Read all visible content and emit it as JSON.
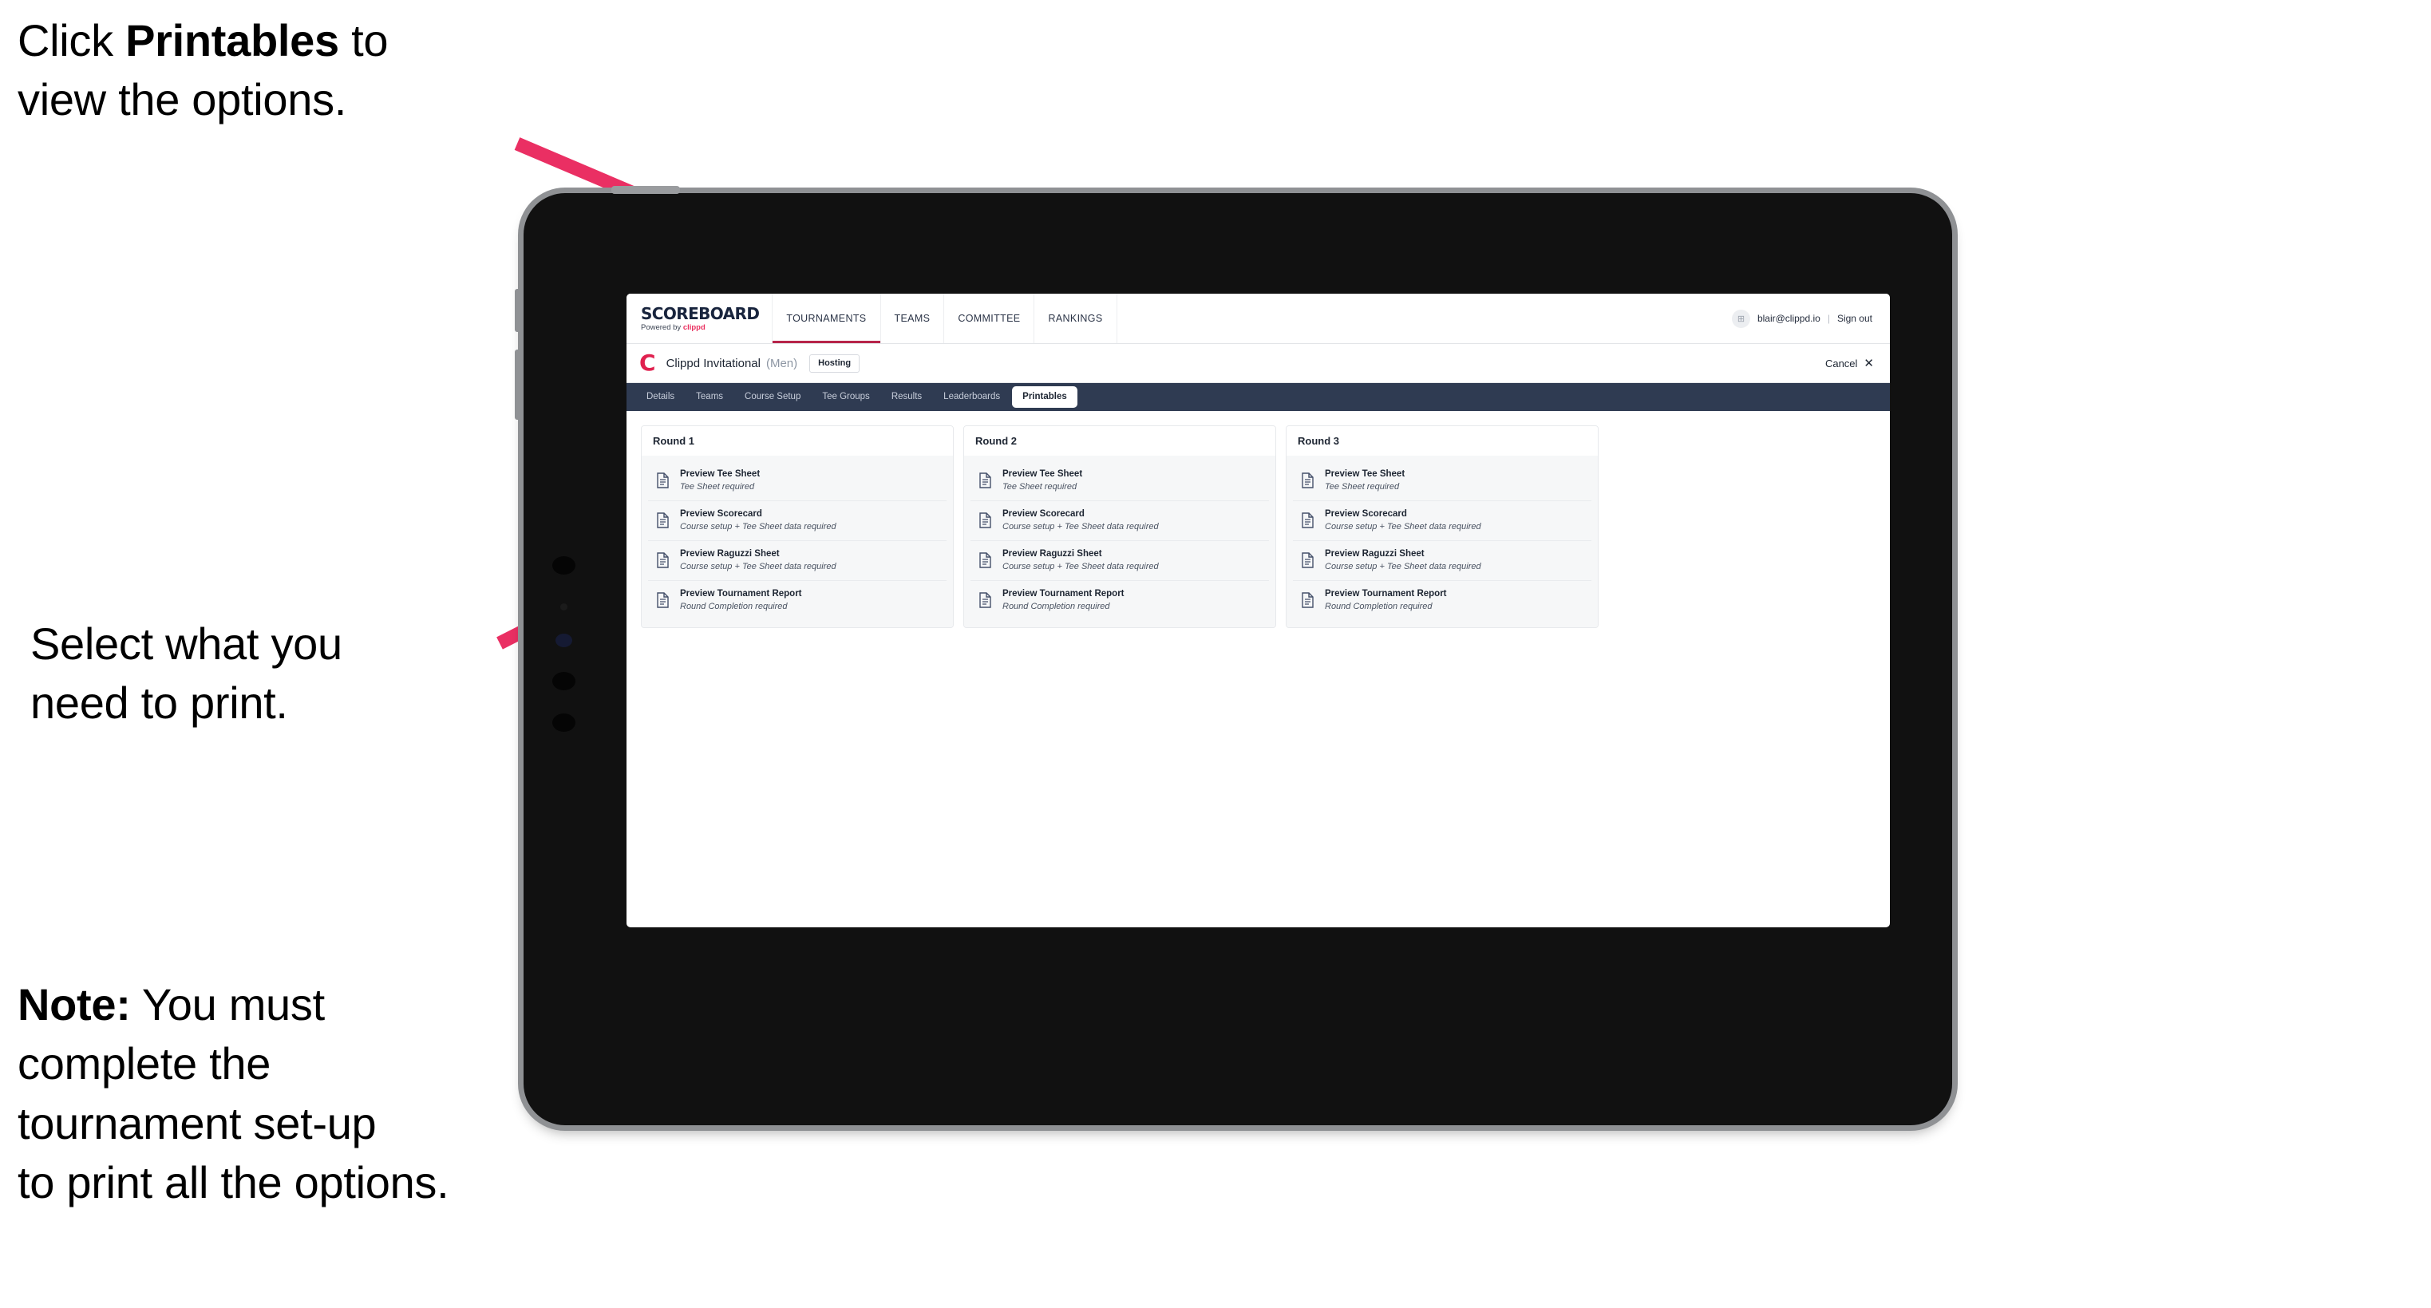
{
  "annotations": {
    "click_printables": "Click Printables to\nview the options.",
    "click_printables_prefix": "Click ",
    "click_printables_bold": "Printables",
    "click_printables_suffix": " to\nview the options.",
    "select_print": "Select what you\n need to print.",
    "note_prefix": "Note:",
    "note_body": " You must\ncomplete the\ntournament set-up\nto print all the options.",
    "arrow_color": "#ea2f63"
  },
  "device": {
    "type": "tablet",
    "bezel_color": "#111111",
    "rail_color": "#8f9194"
  },
  "app": {
    "globalnav": {
      "brand_title": "SCOREBOARD",
      "brand_sub_prefix": "Powered by ",
      "brand_sub_accent": "clippd",
      "items": [
        {
          "label": "TOURNAMENTS",
          "active": true
        },
        {
          "label": "TEAMS",
          "active": false
        },
        {
          "label": "COMMITTEE",
          "active": false
        },
        {
          "label": "RANKINGS",
          "active": false
        }
      ],
      "account_email": "blair@clippd.io",
      "account_separator": "|",
      "sign_out": "Sign out",
      "avatar_glyph": "⊞",
      "active_underline_color": "#b7244a"
    },
    "tournament": {
      "logo_letter": "C",
      "name": "Clippd Invitational",
      "gender": "(Men)",
      "badge": "Hosting",
      "cancel_label": "Cancel",
      "cancel_icon": "✕"
    },
    "tabs": [
      {
        "label": "Details",
        "active": false
      },
      {
        "label": "Teams",
        "active": false
      },
      {
        "label": "Course Setup",
        "active": false
      },
      {
        "label": "Tee Groups",
        "active": false
      },
      {
        "label": "Results",
        "active": false
      },
      {
        "label": "Leaderboards",
        "active": false
      },
      {
        "label": "Printables",
        "active": true
      }
    ],
    "printables": {
      "rounds": [
        {
          "title": "Round 1",
          "items": [
            {
              "title": "Preview Tee Sheet",
              "requirement": "Tee Sheet required"
            },
            {
              "title": "Preview Scorecard",
              "requirement": "Course setup + Tee Sheet data required"
            },
            {
              "title": "Preview Raguzzi Sheet",
              "requirement": "Course setup + Tee Sheet data required"
            },
            {
              "title": "Preview Tournament Report",
              "requirement": "Round Completion required"
            }
          ]
        },
        {
          "title": "Round 2",
          "items": [
            {
              "title": "Preview Tee Sheet",
              "requirement": "Tee Sheet required"
            },
            {
              "title": "Preview Scorecard",
              "requirement": "Course setup + Tee Sheet data required"
            },
            {
              "title": "Preview Raguzzi Sheet",
              "requirement": "Course setup + Tee Sheet data required"
            },
            {
              "title": "Preview Tournament Report",
              "requirement": "Round Completion required"
            }
          ]
        },
        {
          "title": "Round 3",
          "items": [
            {
              "title": "Preview Tee Sheet",
              "requirement": "Tee Sheet required"
            },
            {
              "title": "Preview Scorecard",
              "requirement": "Course setup + Tee Sheet data required"
            },
            {
              "title": "Preview Raguzzi Sheet",
              "requirement": "Course setup + Tee Sheet data required"
            },
            {
              "title": "Preview Tournament Report",
              "requirement": "Round Completion required"
            }
          ]
        }
      ]
    }
  }
}
